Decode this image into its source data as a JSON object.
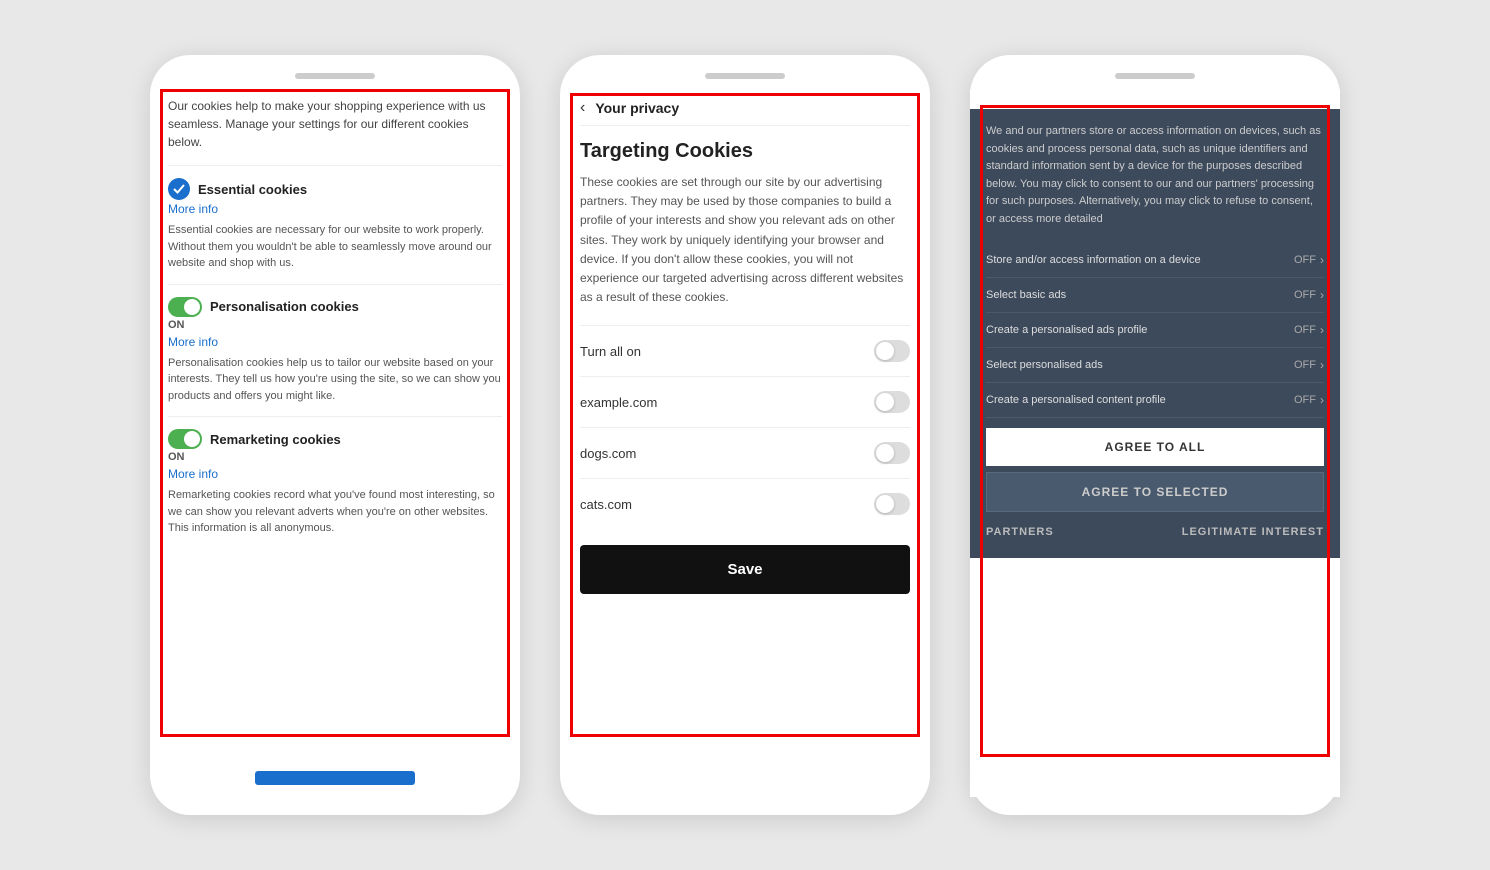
{
  "phone1": {
    "header": "Our cookies help to make your shopping experience with us seamless. Manage your settings for our different cookies below.",
    "sections": [
      {
        "id": "essential",
        "title": "Essential cookies",
        "more_info": "More info",
        "has_check": true,
        "has_toggle": false,
        "on_label": "",
        "desc": "Essential cookies are necessary for our website to work properly. Without them you wouldn't be able to seamlessly move around our website and shop with us."
      },
      {
        "id": "personalisation",
        "title": "Personalisation cookies",
        "more_info": "More info",
        "has_check": false,
        "has_toggle": true,
        "on_label": "ON",
        "desc": "Personalisation cookies help us to tailor our website based on your interests. They tell us how you're using the site, so we can show you products and offers you might like."
      },
      {
        "id": "remarketing",
        "title": "Remarketing cookies",
        "more_info": "More info",
        "has_check": false,
        "has_toggle": true,
        "on_label": "ON",
        "desc": "Remarketing cookies record what you've found most interesting, so we can show you relevant adverts when you're on other websites. This information is all anonymous."
      }
    ]
  },
  "phone2": {
    "back_label": "‹",
    "title": "Your privacy",
    "targeting_title": "Targeting Cookies",
    "desc": "These cookies are set through our site by our advertising partners. They may be used by those companies to build a profile of your interests and show you relevant ads on other sites. They work by uniquely identifying your browser and device. If you don't allow these cookies, you will not experience our targeted advertising across different websites as a result of these cookies.",
    "rows": [
      {
        "label": "Turn all on",
        "has_toggle": true
      },
      {
        "label": "example.com",
        "has_toggle": true
      },
      {
        "label": "dogs.com",
        "has_toggle": true
      },
      {
        "label": "cats.com",
        "has_toggle": true
      }
    ],
    "save_label": "Save"
  },
  "phone3": {
    "desc": "We and our partners store or access information on devices, such as cookies and process personal data, such as unique identifiers and standard information sent by a device for the purposes described below. You may click to consent to our and our partners' processing for such purposes. Alternatively, you may click to refuse to consent, or access more detailed",
    "rows": [
      {
        "label": "Store and/or access information on a device",
        "value": "OFF"
      },
      {
        "label": "Select basic ads",
        "value": "OFF"
      },
      {
        "label": "Create a personalised ads profile",
        "value": "OFF"
      },
      {
        "label": "Select personalised ads",
        "value": "OFF"
      },
      {
        "label": "Create a personalised content profile",
        "value": "OFF"
      }
    ],
    "agree_all": "AGREE TO ALL",
    "agree_selected": "AGREE TO SELECTED",
    "partners": "PARTNERS",
    "legitimate_interest": "LEGITIMATE INTEREST"
  }
}
